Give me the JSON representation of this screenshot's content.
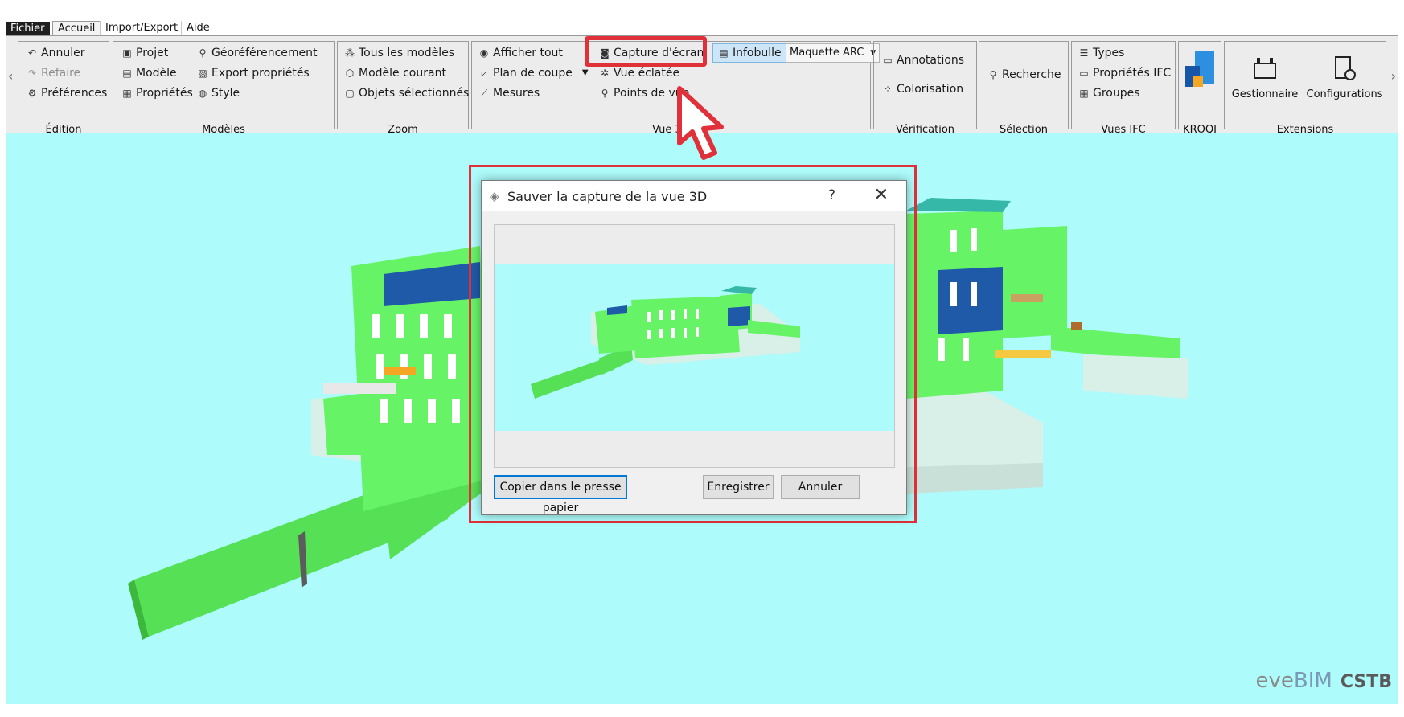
{
  "menu": {
    "tabs": [
      {
        "label": "Fichier"
      },
      {
        "label": "Accueil"
      },
      {
        "label": "Import/Export"
      },
      {
        "label": "Aide"
      }
    ]
  },
  "ribbon": {
    "edition": {
      "title": "Édition",
      "items": [
        "Annuler",
        "Refaire",
        "Préférences"
      ]
    },
    "modeles": {
      "title": "Modèles",
      "col1": [
        "Projet",
        "Modèle",
        "Propriétés"
      ],
      "col2": [
        "Géoréférencement",
        "Export propriétés",
        "Style"
      ]
    },
    "zoom": {
      "title": "Zoom",
      "items": [
        "Tous les modèles",
        "Modèle courant",
        "Objets sélectionnés"
      ]
    },
    "vue3d": {
      "title": "Vue 3D",
      "col1": [
        "Afficher tout",
        "Plan de coupe",
        "Mesures"
      ],
      "col2": [
        "Capture d'écran",
        "Vue éclatée",
        "Points de vue"
      ],
      "infobulle": "Infobulle",
      "dropdown": "Maquette ARC"
    },
    "verification": {
      "title": "Vérification",
      "items": [
        "Annotations",
        "Colorisation"
      ]
    },
    "selection": {
      "title": "Sélection",
      "items": [
        "Recherche"
      ]
    },
    "vuesifc": {
      "title": "Vues IFC",
      "items": [
        "Types",
        "Propriétés IFC",
        "Groupes"
      ]
    },
    "kroqi": {
      "title": "KROQI"
    },
    "extensions": {
      "title": "Extensions",
      "items": [
        "Gestionnaire",
        "Configurations"
      ]
    }
  },
  "dialog": {
    "title": "Sauver la capture de la vue 3D",
    "help": "?",
    "close": "✕",
    "copy_button": "Copier dans le presse papier",
    "save_button": "Enregistrer",
    "cancel_button": "Annuler"
  },
  "brand": {
    "eve": "eve",
    "bim": "BIM",
    "cstb": "CSTB"
  },
  "colors": {
    "highlight": "#e0303a",
    "viewport": "#adfbfb",
    "model_green": "#66f466",
    "model_blue": "#1e5aa8",
    "cursor": "#e0303a"
  },
  "icons": {
    "ribbon_scroll_left": "chevron-left-icon",
    "ribbon_scroll_right": "chevron-right-icon",
    "capture": "camera-icon",
    "infobulle": "tooltip-icon",
    "cursor": "mouse-pointer-icon"
  }
}
